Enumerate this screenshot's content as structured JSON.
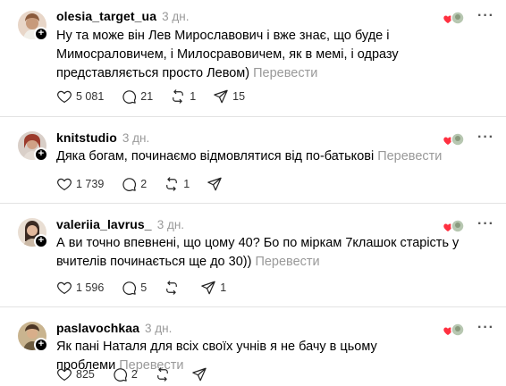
{
  "comments": [
    {
      "username": "olesia_target_ua",
      "time": "3 дн.",
      "text": "Ну та може він Лев Мирославович і вже знає, що буде і Мимосраловичем, і Милосравовичем, як в мемі, і одразу представляється просто Левом)",
      "translate": "Перевести",
      "likes": "5 081",
      "replies": "21",
      "reposts": "1",
      "shares": "15"
    },
    {
      "username": "knitstudio",
      "time": "3 дн.",
      "text": "Дяка богам, починаємо відмовлятися від по-батькові",
      "translate": "Перевести",
      "likes": "1 739",
      "replies": "2",
      "reposts": "1",
      "shares": ""
    },
    {
      "username": "valeriia_lavrus_",
      "time": "3 дн.",
      "text": "А ви точно впевнені, що цому 40? Бо по міркам 7клашок старість у вчителів починається ще до 30))",
      "translate": "Перевести",
      "likes": "1 596",
      "replies": "5",
      "reposts": "",
      "shares": "1"
    },
    {
      "username": "paslavochkaa",
      "time": "3 дн.",
      "text": "Як пані Наталя для всіх своїх учнів я не бачу в цьому проблеми",
      "translate": "Перевести",
      "likes": "825",
      "replies": "2",
      "reposts": "",
      "shares": ""
    }
  ],
  "icons": {
    "like": "heart-icon",
    "reply": "comment-icon",
    "repost": "repost-icon",
    "share": "send-icon",
    "more": "more-icon",
    "follow": "plus-icon"
  },
  "colors": {
    "text": "#000000",
    "muted": "#999999",
    "divider": "#e3e3e3",
    "like_red": "#ff3040"
  }
}
